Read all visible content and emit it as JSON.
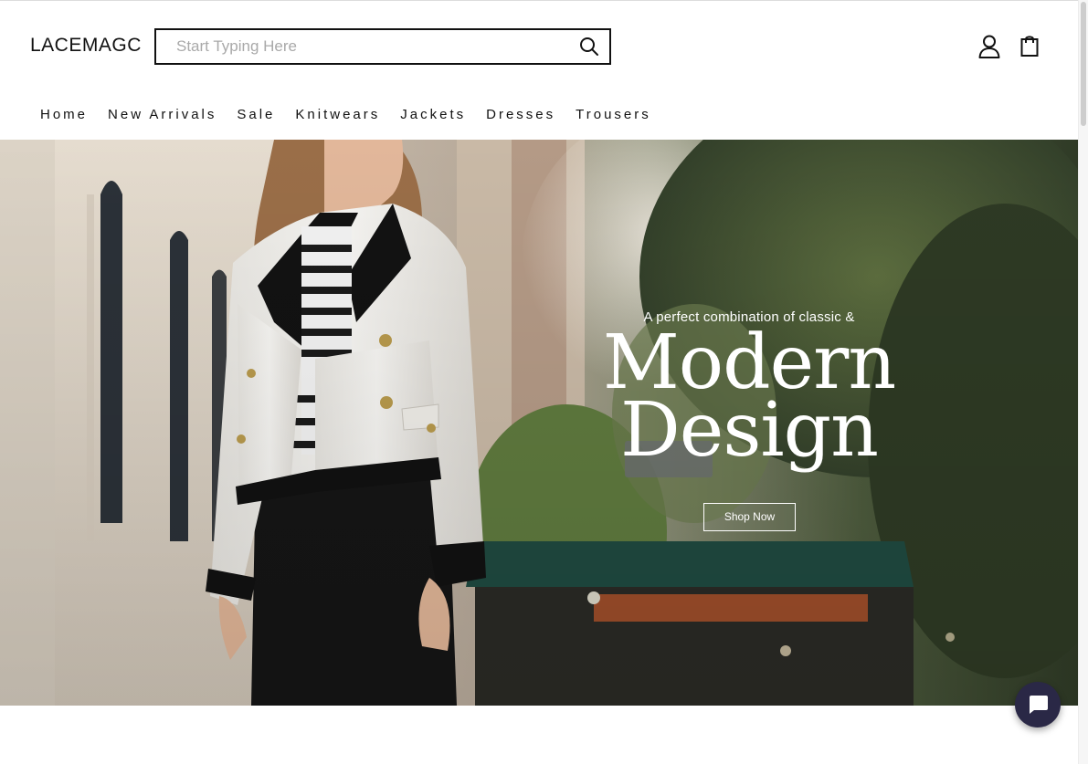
{
  "header": {
    "logo": "LACEMAGC",
    "search_placeholder": "Start Typing Here"
  },
  "nav": {
    "items": [
      "Home",
      "New Arrivals",
      "Sale",
      "Knitwears",
      "Jackets",
      "Dresses",
      "Trousers"
    ]
  },
  "hero": {
    "eyebrow": "A perfect combination of classic &",
    "title_line1": "Modern",
    "title_line2": "Design",
    "cta": "Shop Now"
  },
  "icons": {
    "search": "search-icon",
    "account": "user-icon",
    "cart": "shopping-bag-icon",
    "chat": "chat-icon"
  },
  "colors": {
    "text": "#111111",
    "chat_button": "#2a2846",
    "hero_text": "#ffffff"
  }
}
